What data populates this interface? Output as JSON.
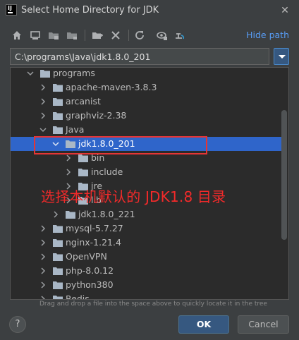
{
  "window": {
    "title": "Select Home Directory for JDK",
    "logo_text": "IJ",
    "close_glyph": "✕"
  },
  "toolbar": {
    "icons": [
      "home-icon",
      "desktop-icon",
      "project-folder-icon",
      "module-folder-icon",
      "new-folder-icon",
      "delete-icon",
      "refresh-icon",
      "show-hidden-icon",
      "link-icon"
    ],
    "hide_path_label": "Hide path"
  },
  "path": {
    "value": "C:\\programs\\Java\\jdk1.8.0_201"
  },
  "tree": {
    "rows": [
      {
        "label": "programs",
        "expanded": true
      },
      {
        "label": "apache-maven-3.8.3",
        "expanded": false
      },
      {
        "label": "arcanist",
        "expanded": false
      },
      {
        "label": "graphviz-2.38",
        "expanded": false
      },
      {
        "label": "Java",
        "expanded": true
      },
      {
        "label": "jdk1.8.0_201",
        "expanded": true,
        "selected": true
      },
      {
        "label": "bin",
        "expanded": false
      },
      {
        "label": "include",
        "expanded": false
      },
      {
        "label": "jre",
        "expanded": false
      },
      {
        "label": "lib",
        "expanded": false
      },
      {
        "label": "jdk1.8.0_221",
        "expanded": false
      },
      {
        "label": "mysql-5.7.27",
        "expanded": false
      },
      {
        "label": "nginx-1.21.4",
        "expanded": false
      },
      {
        "label": "OpenVPN",
        "expanded": false
      },
      {
        "label": "php-8.0.12",
        "expanded": false
      },
      {
        "label": "python380",
        "expanded": false
      },
      {
        "label": "Redis",
        "expanded": false
      }
    ]
  },
  "annotation": {
    "text": "选择本机默认的 JDK1.8 目录",
    "color": "#f22a2a"
  },
  "hint": "Drag and drop a file into the space above to quickly locate it in the tree",
  "buttons": {
    "help": "?",
    "ok": "OK",
    "cancel": "Cancel"
  },
  "colors": {
    "accent": "#589df6",
    "selection": "#2f65ca",
    "folder": "#a9b7c6"
  }
}
